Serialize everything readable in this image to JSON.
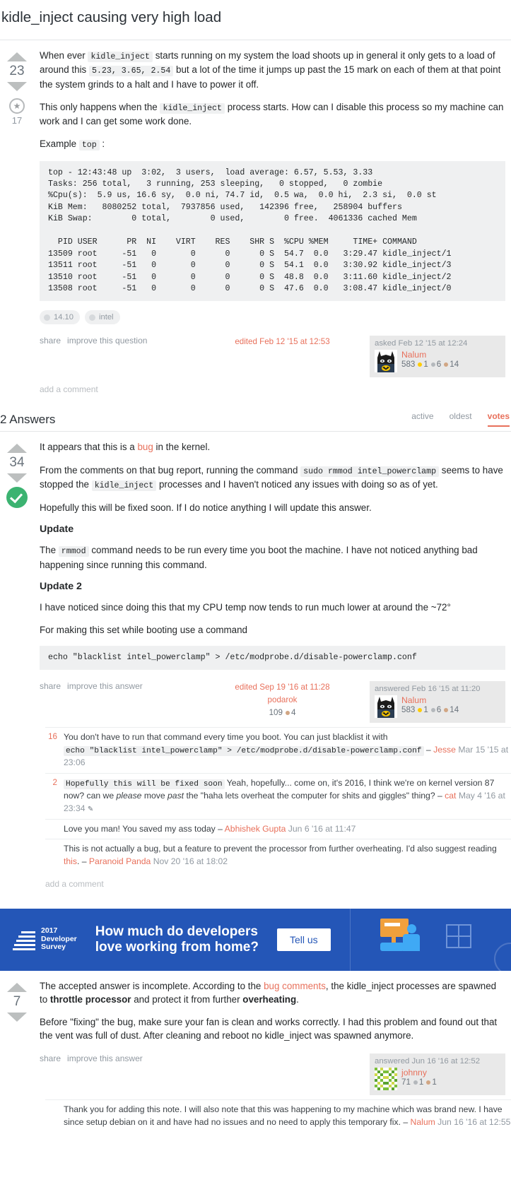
{
  "question": {
    "title": "kidle_inject causing very high load",
    "votes": "23",
    "favorites": "17",
    "body": {
      "p1_a": "When ever ",
      "p1_code1": "kidle_inject",
      "p1_b": " starts running on my system the load shoots up in general it only gets to a load of around this ",
      "p1_code2": "5.23, 3.65, 2.54",
      "p1_c": " but a lot of the time it jumps up past the 15 mark on each of them at that point the system grinds to a halt and I have to power it off.",
      "p2_a": "This only happens when the ",
      "p2_code1": "kidle_inject",
      "p2_b": " process starts. How can I disable this process so my machine can work and I can get some work done.",
      "p3_a": "Example ",
      "p3_code1": "top",
      "p3_b": " :"
    },
    "code_block": "top - 12:43:48 up  3:02,  3 users,  load average: 6.57, 5.53, 3.33\nTasks: 256 total,   3 running, 253 sleeping,   0 stopped,   0 zombie\n%Cpu(s):  5.9 us, 16.6 sy,  0.0 ni, 74.7 id,  0.5 wa,  0.0 hi,  2.3 si,  0.0 st\nKiB Mem:   8080252 total,  7937856 used,   142396 free,   258904 buffers\nKiB Swap:        0 total,        0 used,        0 free.  4061336 cached Mem\n\n  PID USER      PR  NI    VIRT    RES    SHR S  %CPU %MEM     TIME+ COMMAND\n13509 root     -51   0       0      0      0 S  54.7  0.0   3:29.47 kidle_inject/1\n13511 root     -51   0       0      0      0 S  54.1  0.0   3:30.92 kidle_inject/3\n13510 root     -51   0       0      0      0 S  48.8  0.0   3:11.60 kidle_inject/2\n13508 root     -51   0       0      0      0 S  47.6  0.0   3:08.47 kidle_inject/0",
    "tags": [
      "14.10",
      "intel"
    ],
    "menu": {
      "share": "share",
      "improve": "improve this question"
    },
    "edited": "edited Feb 12 '15 at 12:53",
    "asked": {
      "action": "asked Feb 12 '15 at 12:24",
      "user": "Nalum",
      "rep": "583",
      "gold": "1",
      "silver": "6",
      "bronze": "14"
    },
    "add_comment": "add a comment"
  },
  "answers_header": {
    "title": "2 Answers",
    "tabs": [
      {
        "label": "active",
        "active": false
      },
      {
        "label": "oldest",
        "active": false
      },
      {
        "label": "votes",
        "active": true
      }
    ]
  },
  "answer1": {
    "votes": "34",
    "accepted": true,
    "p1_a": "It appears that this is a ",
    "p1_link": "bug",
    "p1_b": " in the kernel.",
    "p2_a": "From the comments on that bug report, running the command ",
    "p2_code1": "sudo rmmod intel_powerclamp",
    "p2_b": " seems to have stopped the ",
    "p2_code2": "kidle_inject",
    "p2_c": " processes and I haven't noticed any issues with doing so as of yet.",
    "p3": "Hopefully this will be fixed soon. If I do notice anything I will update this answer.",
    "h_update": "Update",
    "p4_a": "The ",
    "p4_code1": "rmmod",
    "p4_b": " command needs to be run every time you boot the machine. I have not noticed anything bad happening since running this command.",
    "h_update2": "Update 2",
    "p5": "I have noticed since doing this that my CPU temp now tends to run much lower at around the ~72°",
    "p6": "For making this set while booting use a command",
    "code_block": "echo \"blacklist intel_powerclamp\" > /etc/modprobe.d/disable-powerclamp.conf",
    "menu": {
      "share": "share",
      "improve": "improve this answer"
    },
    "edited": "edited Sep 19 '16 at 11:28",
    "editor": {
      "user": "podarok",
      "rep": "109",
      "bronze": "4"
    },
    "answered": {
      "action": "answered Feb 16 '15 at 11:20",
      "user": "Nalum",
      "rep": "583",
      "gold": "1",
      "silver": "6",
      "bronze": "14"
    },
    "comments": [
      {
        "score": "16",
        "text_a": "You don't have to run that command every time you boot. You can just blacklist it with ",
        "code": "echo \"blacklist intel_powerclamp\" > /etc/modprobe.d/disable-powerclamp.conf",
        "text_b": " – ",
        "user": "Jesse",
        "date": " Mar 15 '15 at 23:06",
        "edited": false
      },
      {
        "score": "2",
        "code_lead": "Hopefully this will be fixed soon",
        "text_a": " Yeah, hopefully... come on, it's 2016, I think we're on kernel version 87 now? can we ",
        "em1": "please",
        "text_b": " move ",
        "em2": "past",
        "text_c": " the \"haha lets overheat the computer for shits and giggles\" thing? – ",
        "user": "cat",
        "date": " May 4 '16 at 23:34",
        "edited": true
      },
      {
        "score": "",
        "text_a": "Love you man! You saved my ass today – ",
        "user": "Abhishek Gupta",
        "date": " Jun 6 '16 at 11:47",
        "edited": false
      },
      {
        "score": "",
        "text_a": "This is not actually a bug, but a feature to prevent the processor from further overheating. I'd also suggest reading ",
        "link": "this",
        "text_b": ". – ",
        "user": "Paranoid Panda",
        "date": " Nov 20 '16 at 18:02",
        "edited": false
      }
    ],
    "add_comment": "add a comment"
  },
  "banner": {
    "year": "2017",
    "line1": "Developer",
    "line2": "Survey",
    "headline1": "How much do developers",
    "headline2": "love working from home?",
    "button": "Tell us",
    "bg_color": "#2456b7"
  },
  "answer2": {
    "votes": "7",
    "p1_a": "The accepted answer is incomplete. According to the ",
    "p1_link": "bug comments",
    "p1_b": ", the kidle_inject processes are spawned to ",
    "p1_bold1": "throttle processor",
    "p1_c": " and protect it from further ",
    "p1_bold2": "overheating",
    "p1_d": ".",
    "p2": "Before \"fixing\" the bug, make sure your fan is clean and works correctly. I had this problem and found out that the vent was full of dust. After cleaning and reboot no kidle_inject was spawned anymore.",
    "menu": {
      "share": "share",
      "improve": "improve this answer"
    },
    "answered": {
      "action": "answered Jun 16 '16 at 12:52",
      "user": "johnny",
      "rep": "71",
      "silver": "1",
      "bronze": "1"
    },
    "comments": [
      {
        "score": "",
        "text_a": "Thank you for adding this note. I will also note that this was happening to my machine which was brand new. I have since setup debian on it and have had no issues and no need to apply this temporary fix. – ",
        "user": "Nalum",
        "date": " Jun 16 '16 at 12:55",
        "edited": false
      }
    ]
  }
}
